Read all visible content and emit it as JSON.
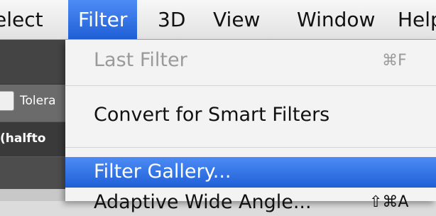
{
  "menubar": {
    "items": [
      {
        "label": "elect"
      },
      {
        "label": "Filter"
      },
      {
        "label": "3D"
      },
      {
        "label": "View"
      },
      {
        "label": "Window"
      },
      {
        "label": "Help"
      }
    ]
  },
  "left_panel": {
    "tolerance_label": "Tolera",
    "halftone_label": "(halfto"
  },
  "filter_menu": {
    "last_filter": {
      "label": "Last Filter",
      "shortcut": "⌘F"
    },
    "convert_smart": {
      "label": "Convert for Smart Filters"
    },
    "filter_gallery": {
      "label": "Filter Gallery..."
    },
    "adaptive_wide_angle": {
      "label": "Adaptive Wide Angle...",
      "shortcut": "⇧⌘A"
    }
  },
  "colors": {
    "highlight": "#2f6fe0",
    "menu_bg": "#f3f3f3",
    "disabled_text": "#9a9a9a"
  }
}
